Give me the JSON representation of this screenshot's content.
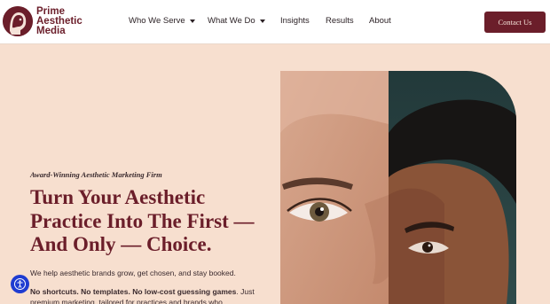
{
  "brand": {
    "line1": "Prime",
    "line2": "Aesthetic",
    "line3": "Media"
  },
  "nav": {
    "items": [
      {
        "label": "Who We Serve",
        "has_dropdown": true
      },
      {
        "label": "What We Do",
        "has_dropdown": true
      },
      {
        "label": "Insights",
        "has_dropdown": false
      },
      {
        "label": "Results",
        "has_dropdown": false
      },
      {
        "label": "About",
        "has_dropdown": false
      }
    ],
    "cta_label": "Contact Us"
  },
  "hero": {
    "eyebrow": "Award-Winning Aesthetic Marketing Firm",
    "headline_line1": "Turn Your Aesthetic",
    "headline_line2": "Practice Into The First —",
    "headline_line3": "And Only — Choice.",
    "subtext": "We help aesthetic brands grow, get chosen, and stay booked.",
    "subtext2_bold": "No shortcuts. No templates. No low-cost guessing games",
    "subtext2_rest": ". Just premium marketing, tailored for practices and brands who"
  },
  "colors": {
    "brand": "#6b1e2a",
    "background": "#f7dfcf",
    "accessibility": "#1f3cd1"
  },
  "icons": {
    "accessibility": "accessibility-icon",
    "logo": "woman-portrait-logo-icon"
  }
}
